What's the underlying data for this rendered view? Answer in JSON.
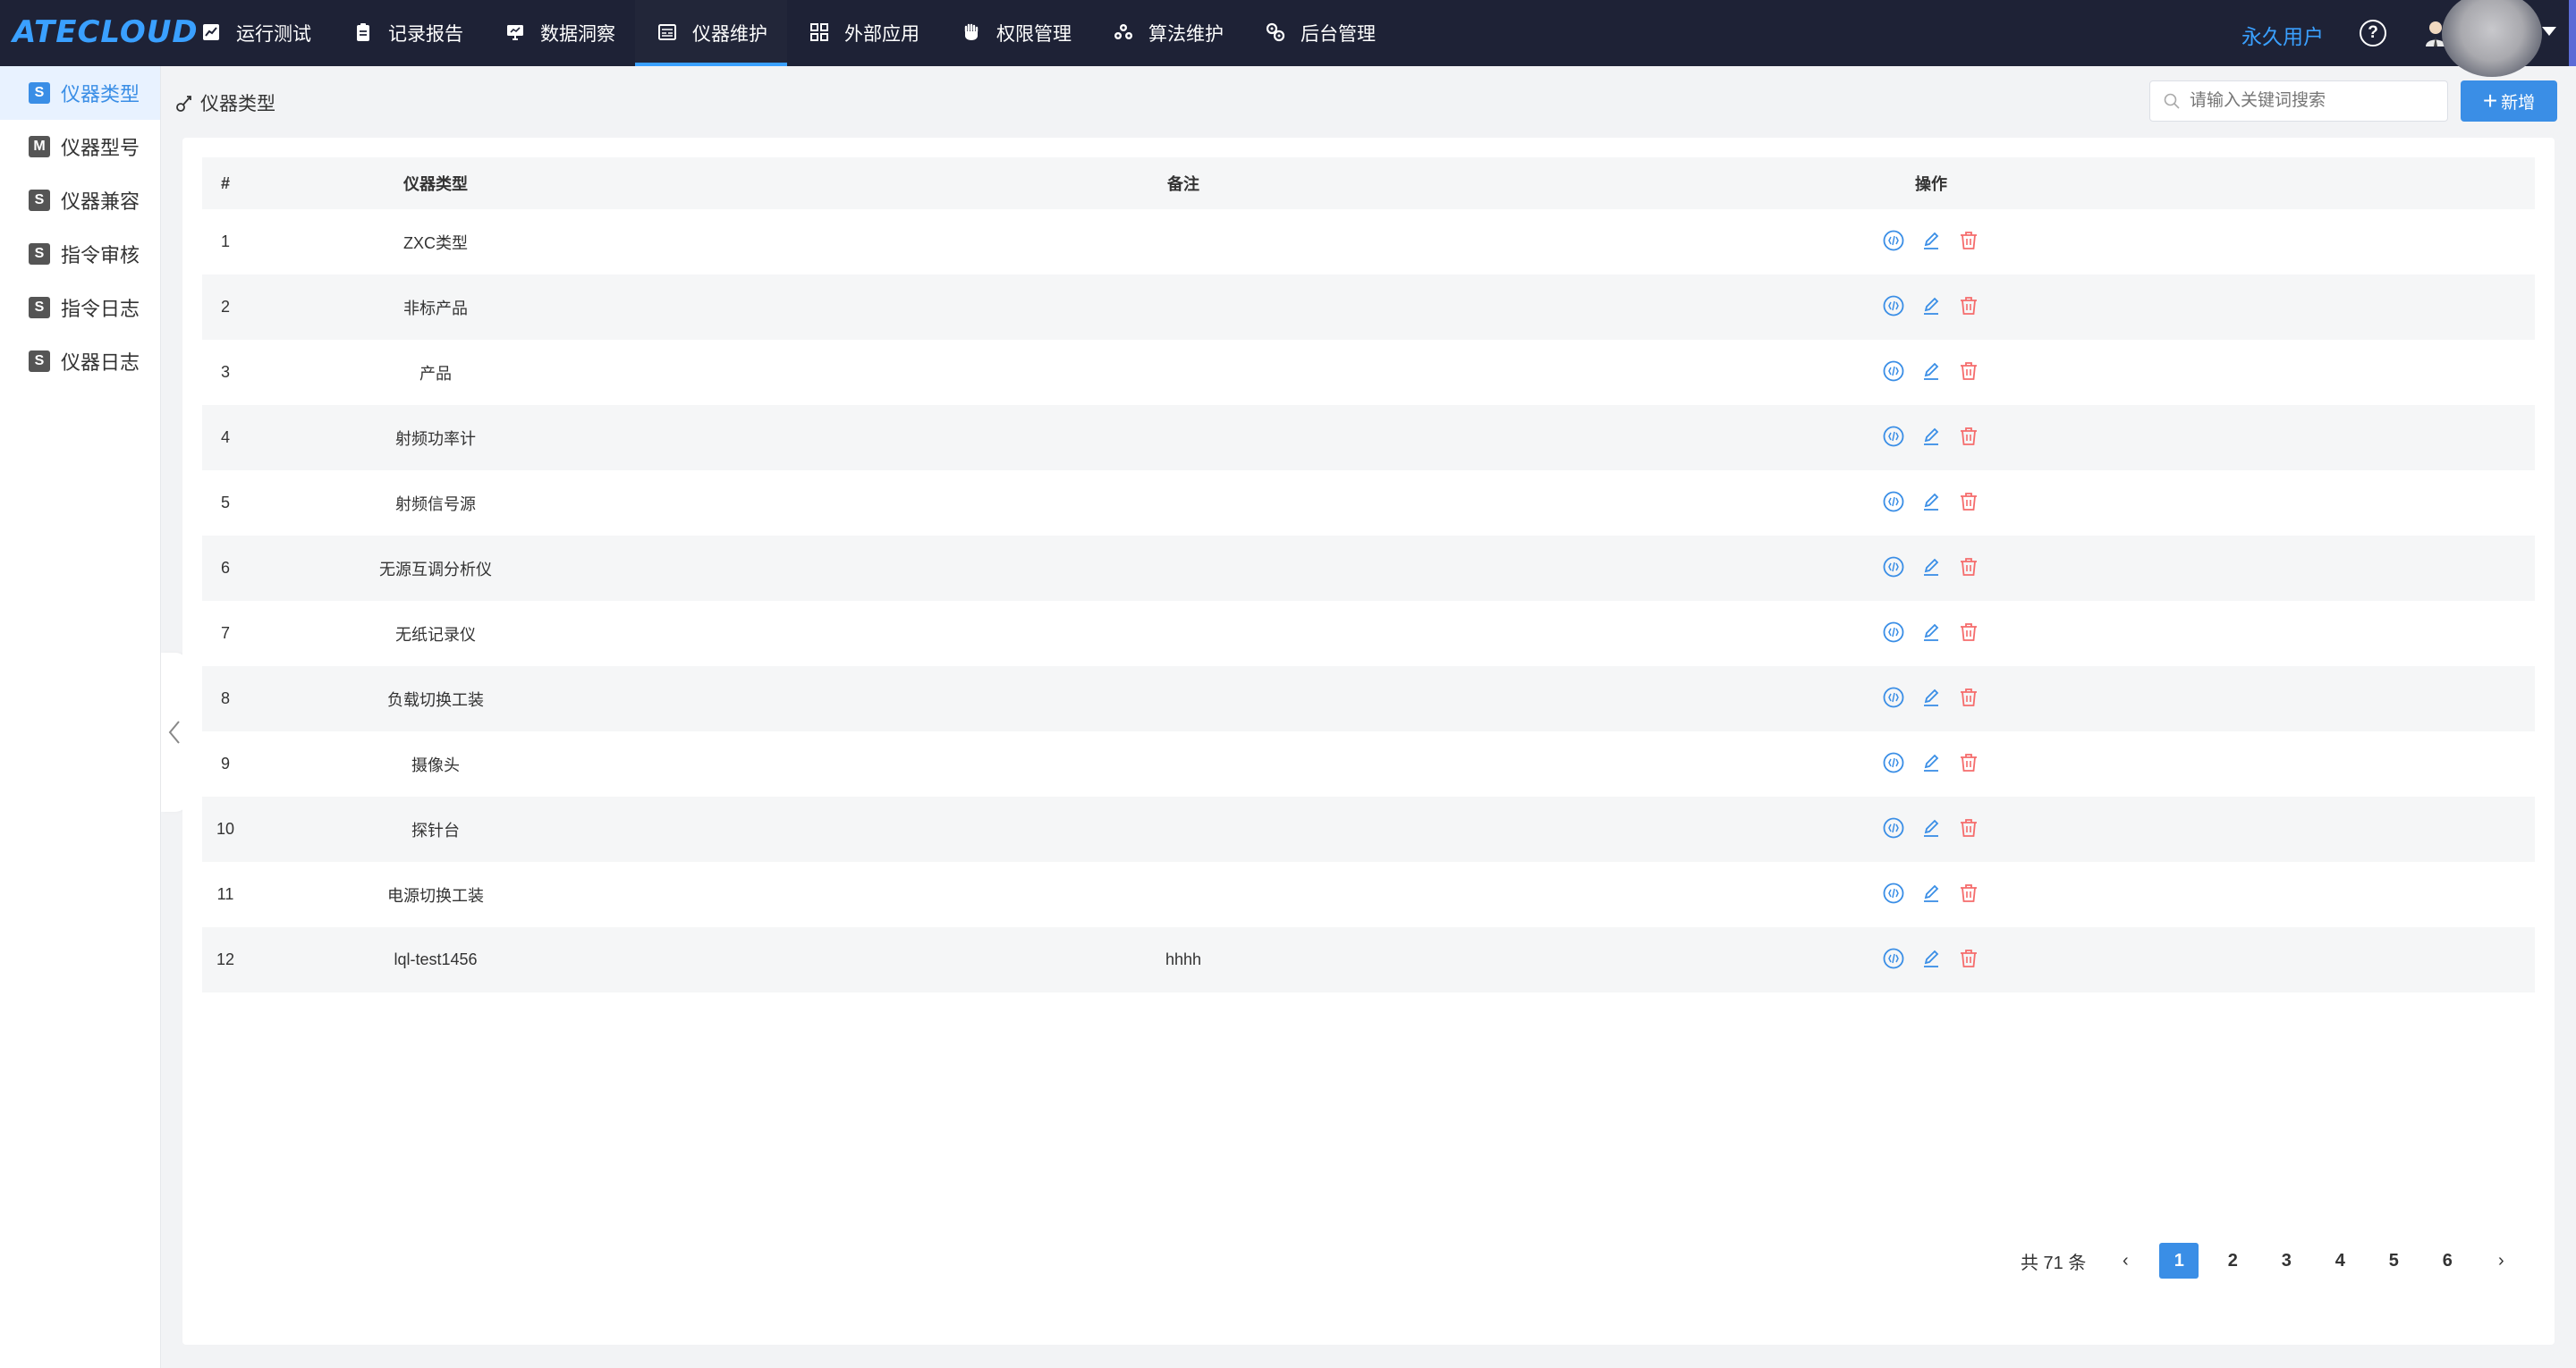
{
  "app": {
    "logo": "ATECLOUD"
  },
  "nav": [
    {
      "label": "运行测试",
      "icon": "chart-icon"
    },
    {
      "label": "记录报告",
      "icon": "clipboard-icon"
    },
    {
      "label": "数据洞察",
      "icon": "monitor-icon"
    },
    {
      "label": "仪器维护",
      "icon": "instrument-icon",
      "active": true
    },
    {
      "label": "外部应用",
      "icon": "grid-icon"
    },
    {
      "label": "权限管理",
      "icon": "hand-icon"
    },
    {
      "label": "算法维护",
      "icon": "cluster-icon"
    },
    {
      "label": "后台管理",
      "icon": "gear-link-icon"
    }
  ],
  "user": {
    "label": "永久用户",
    "help": "?"
  },
  "sidebar": [
    {
      "badge": "S",
      "label": "仪器类型",
      "active": true
    },
    {
      "badge": "M",
      "label": "仪器型号"
    },
    {
      "badge": "S",
      "label": "仪器兼容"
    },
    {
      "badge": "S",
      "label": "指令审核"
    },
    {
      "badge": "S",
      "label": "指令日志"
    },
    {
      "badge": "S",
      "label": "仪器日志"
    }
  ],
  "page": {
    "breadcrumb": "仪器类型",
    "search_placeholder": "请输入关键词搜索",
    "add_label": "新增"
  },
  "table": {
    "headers": [
      "#",
      "仪器类型",
      "备注",
      "操作"
    ],
    "rows": [
      {
        "no": "1",
        "type": "ZXC类型",
        "note": ""
      },
      {
        "no": "2",
        "type": "非标产品",
        "note": ""
      },
      {
        "no": "3",
        "type": "产品",
        "note": ""
      },
      {
        "no": "4",
        "type": "射频功率计",
        "note": ""
      },
      {
        "no": "5",
        "type": "射频信号源",
        "note": ""
      },
      {
        "no": "6",
        "type": "无源互调分析仪",
        "note": ""
      },
      {
        "no": "7",
        "type": "无纸记录仪",
        "note": ""
      },
      {
        "no": "8",
        "type": "负载切换工装",
        "note": ""
      },
      {
        "no": "9",
        "type": "摄像头",
        "note": ""
      },
      {
        "no": "10",
        "type": "探针台",
        "note": ""
      },
      {
        "no": "11",
        "type": "电源切换工装",
        "note": ""
      },
      {
        "no": "12",
        "type": "lql-test1456",
        "note": "hhhh"
      }
    ]
  },
  "pagination": {
    "total": "共 71 条",
    "pages": [
      "1",
      "2",
      "3",
      "4",
      "5",
      "6"
    ],
    "current": "1",
    "prev": "‹",
    "next": "›"
  },
  "colors": {
    "accent": "#3a8ee6",
    "topbar": "#1e2236",
    "delete": "#f56c6c"
  }
}
